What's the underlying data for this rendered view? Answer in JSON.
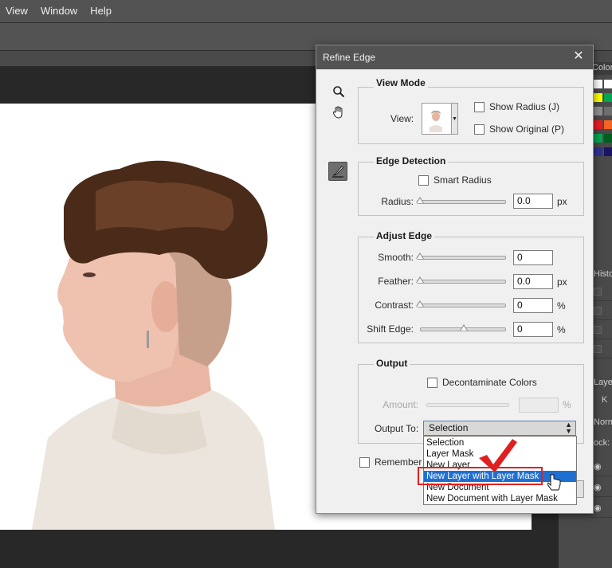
{
  "menubar": {
    "items": [
      "View",
      "Window",
      "Help"
    ]
  },
  "right_panel": {
    "color_tab": "Color",
    "history_tab": "Histo",
    "layers_tab": "Layer",
    "search_kind": "K",
    "blend_mode": "Norm",
    "lock_label": "ock:"
  },
  "dialog": {
    "title": "Refine Edge",
    "close_symbol": "✕",
    "view_mode": {
      "title": "View Mode",
      "view_label": "View:",
      "show_radius": "Show Radius (J)",
      "show_original": "Show Original (P)"
    },
    "edge_detection": {
      "title": "Edge Detection",
      "smart_radius": "Smart Radius",
      "radius_label": "Radius:",
      "radius_value": "0.0",
      "radius_unit": "px"
    },
    "adjust_edge": {
      "title": "Adjust Edge",
      "smooth_label": "Smooth:",
      "smooth_value": "0",
      "feather_label": "Feather:",
      "feather_value": "0.0",
      "feather_unit": "px",
      "contrast_label": "Contrast:",
      "contrast_value": "0",
      "contrast_unit": "%",
      "shift_label": "Shift Edge:",
      "shift_value": "0",
      "shift_unit": "%"
    },
    "output": {
      "title": "Output",
      "decontaminate": "Decontaminate Colors",
      "amount_label": "Amount:",
      "amount_unit": "%",
      "output_to_label": "Output To:",
      "output_to_value": "Selection",
      "options": [
        "Selection",
        "Layer Mask",
        "New Layer",
        "New Layer with Layer Mask",
        "New Document",
        "New Document with Layer Mask"
      ],
      "selected_option": "New Layer with Layer Mask"
    },
    "remember_label": "Remember S"
  },
  "colors": {
    "highlight": "#1f6fd3",
    "annotation_red": "#e02020"
  }
}
